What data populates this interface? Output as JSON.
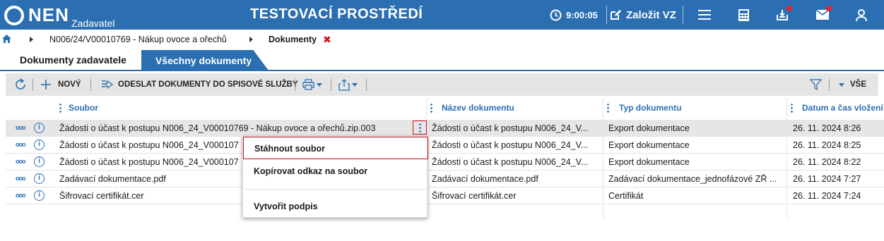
{
  "header": {
    "logo_text": "NEN",
    "logo_sub": "Zadavatel",
    "environment": "TESTOVACÍ PROSTŘEDÍ",
    "session_time": "9:00:05",
    "create_label": "Založit VZ",
    "brand_color": "#2b6fb2",
    "icons": [
      "clock-icon",
      "edit-icon",
      "hamburger-icon",
      "calculator-icon",
      "inbox-icon",
      "mail-icon",
      "user-icon"
    ]
  },
  "breadcrumb": {
    "items": [
      "N006/24/V00010769 - Nákup ovoce a ořechů",
      "Dokumenty"
    ],
    "close": "✖"
  },
  "tabs": [
    {
      "label": "Dokumenty zadavatele",
      "active": true
    },
    {
      "label": "Všechny dokumenty",
      "active": false
    }
  ],
  "toolbar": {
    "new_label": "NOVÝ",
    "send_label": "ODESLAT DOKUMENTY DO SPISOVÉ SLUŽBY",
    "filter_label": "VŠE"
  },
  "table": {
    "columns": [
      "Soubor",
      "Název dokumentu",
      "Typ dokumentu",
      "Datum a čas vložení"
    ],
    "rows": [
      {
        "file": "Žádosti o účast k postupu N006_24_V00010769 - Nákup ovoce a ořechů.zip.003",
        "name": "Žádosti o účast k postupu N006_24_V...",
        "type": "Export dokumentace",
        "date": "26. 11. 2024 8:26"
      },
      {
        "file": "Žádosti o účast k postupu N006_24_V000107",
        "name": "Žádosti o účast k postupu N006_24_V...",
        "type": "Export dokumentace",
        "date": "26. 11. 2024 8:25"
      },
      {
        "file": "Žádosti o účast k postupu N006_24_V000107",
        "name": "Žádosti o účast k postupu N006_24_V...",
        "type": "Export dokumentace",
        "date": "26. 11. 2024 8:22"
      },
      {
        "file": "Zadávací dokumentace.pdf",
        "name": "Zadávací dokumentace.pdf",
        "type": "Zadávací dokumentace_jednofázové ZŘ ...",
        "date": "26. 11. 2024 7:27"
      },
      {
        "file": "Šifrovací certifikát.cer",
        "name": "Šifrovací certifikát.cer",
        "type": "Certifikát",
        "date": "26. 11. 2024 7:24"
      }
    ]
  },
  "context_menu": {
    "items": [
      "Stáhnout soubor",
      "Kopírovat odkaz na soubor",
      "Vytvořit podpis"
    ]
  }
}
